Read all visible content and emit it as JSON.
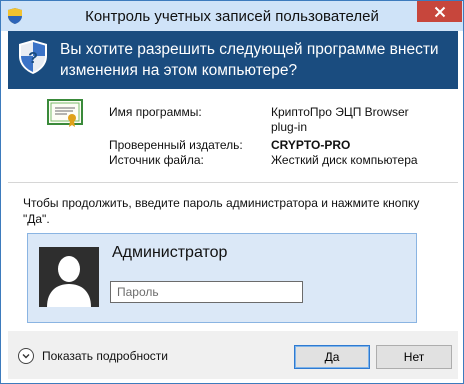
{
  "window": {
    "title": "Контроль учетных записей пользователей"
  },
  "header": {
    "question": "Вы хотите разрешить следующей программе внести изменения на этом компьютере?"
  },
  "details": {
    "program_label": "Имя программы:",
    "program_value_line1": "КриптоПро ЭЦП Browser",
    "program_value_line2": "plug-in",
    "publisher_label": "Проверенный издатель:",
    "publisher_value": "CRYPTO-PRO",
    "source_label": "Источник файла:",
    "source_value": "Жесткий диск компьютера"
  },
  "prompt": "Чтобы продолжить, введите пароль администратора и нажмите кнопку \"Да\".",
  "credential": {
    "username": "Администратор",
    "password_placeholder": "Пароль",
    "password_value": ""
  },
  "footer": {
    "show_details_label": "Показать подробности",
    "yes_label": "Да",
    "no_label": "Нет"
  },
  "colors": {
    "header_bg": "#1a4c7f",
    "titlebar_bg": "#cfe3f8",
    "close_bg": "#c7463c",
    "tile_bg": "#dbe8f7",
    "footer_bg": "#f0f0f0"
  }
}
